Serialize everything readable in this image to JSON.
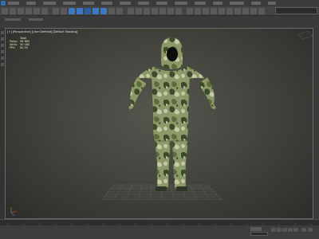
{
  "colors": {
    "menubar": "#3b3b3b",
    "toolbar": "#444444",
    "accent": "#3b78c4",
    "viewport_center": "#56564f",
    "grid": "#6e6e6e",
    "axis_red": "#b33a3a",
    "axis_green": "#4a9a4a",
    "camo_base": "#8c9a6a",
    "camo_dark": "#3e4a2c",
    "camo_mid": "#6b7a48",
    "camo_light": "#c6c9a8"
  },
  "menubar": {
    "item_count": 15
  },
  "toolbar": {
    "icons": [
      "undo-icon",
      "redo-icon",
      "link-icon",
      "unlink-icon",
      "bind-space-warp-icon",
      "selection-filter-icon",
      "select-object-icon",
      "select-by-name-icon",
      "rectangular-selection-icon",
      "window-crossing-icon",
      "select-move-icon",
      "select-rotate-icon",
      "select-scale-icon",
      "reference-coordinate-icon",
      "pivot-center-icon",
      "select-manipulate-icon",
      "keyboard-shortcut-icon",
      "snaps-toggle-icon",
      "angle-snap-icon",
      "percent-snap-icon",
      "spinner-snap-icon",
      "named-selection-icon",
      "mirror-icon",
      "align-icon",
      "toggle-scene-explorer-icon",
      "toggle-layer-explorer-icon",
      "curve-editor-icon",
      "schematic-view-icon",
      "material-editor-icon",
      "render-setup-icon",
      "rendered-frame-window-icon",
      "render-production-icon"
    ]
  },
  "viewport": {
    "label": "[+] [Perspective] [User Defined] [Default Shading]",
    "stats": [
      {
        "key": "",
        "value": "Total"
      },
      {
        "key": "Polys:",
        "value": "98 862"
      },
      {
        "key": "Verts:",
        "value": "50 460"
      },
      {
        "key": "FPS:",
        "value": "60.53"
      }
    ]
  },
  "statusbar": {
    "auto_key_label": "Auto Key",
    "set_key_label": "Set Key",
    "selected_label": "Selected",
    "key_filters_label": "Key Filters..."
  }
}
